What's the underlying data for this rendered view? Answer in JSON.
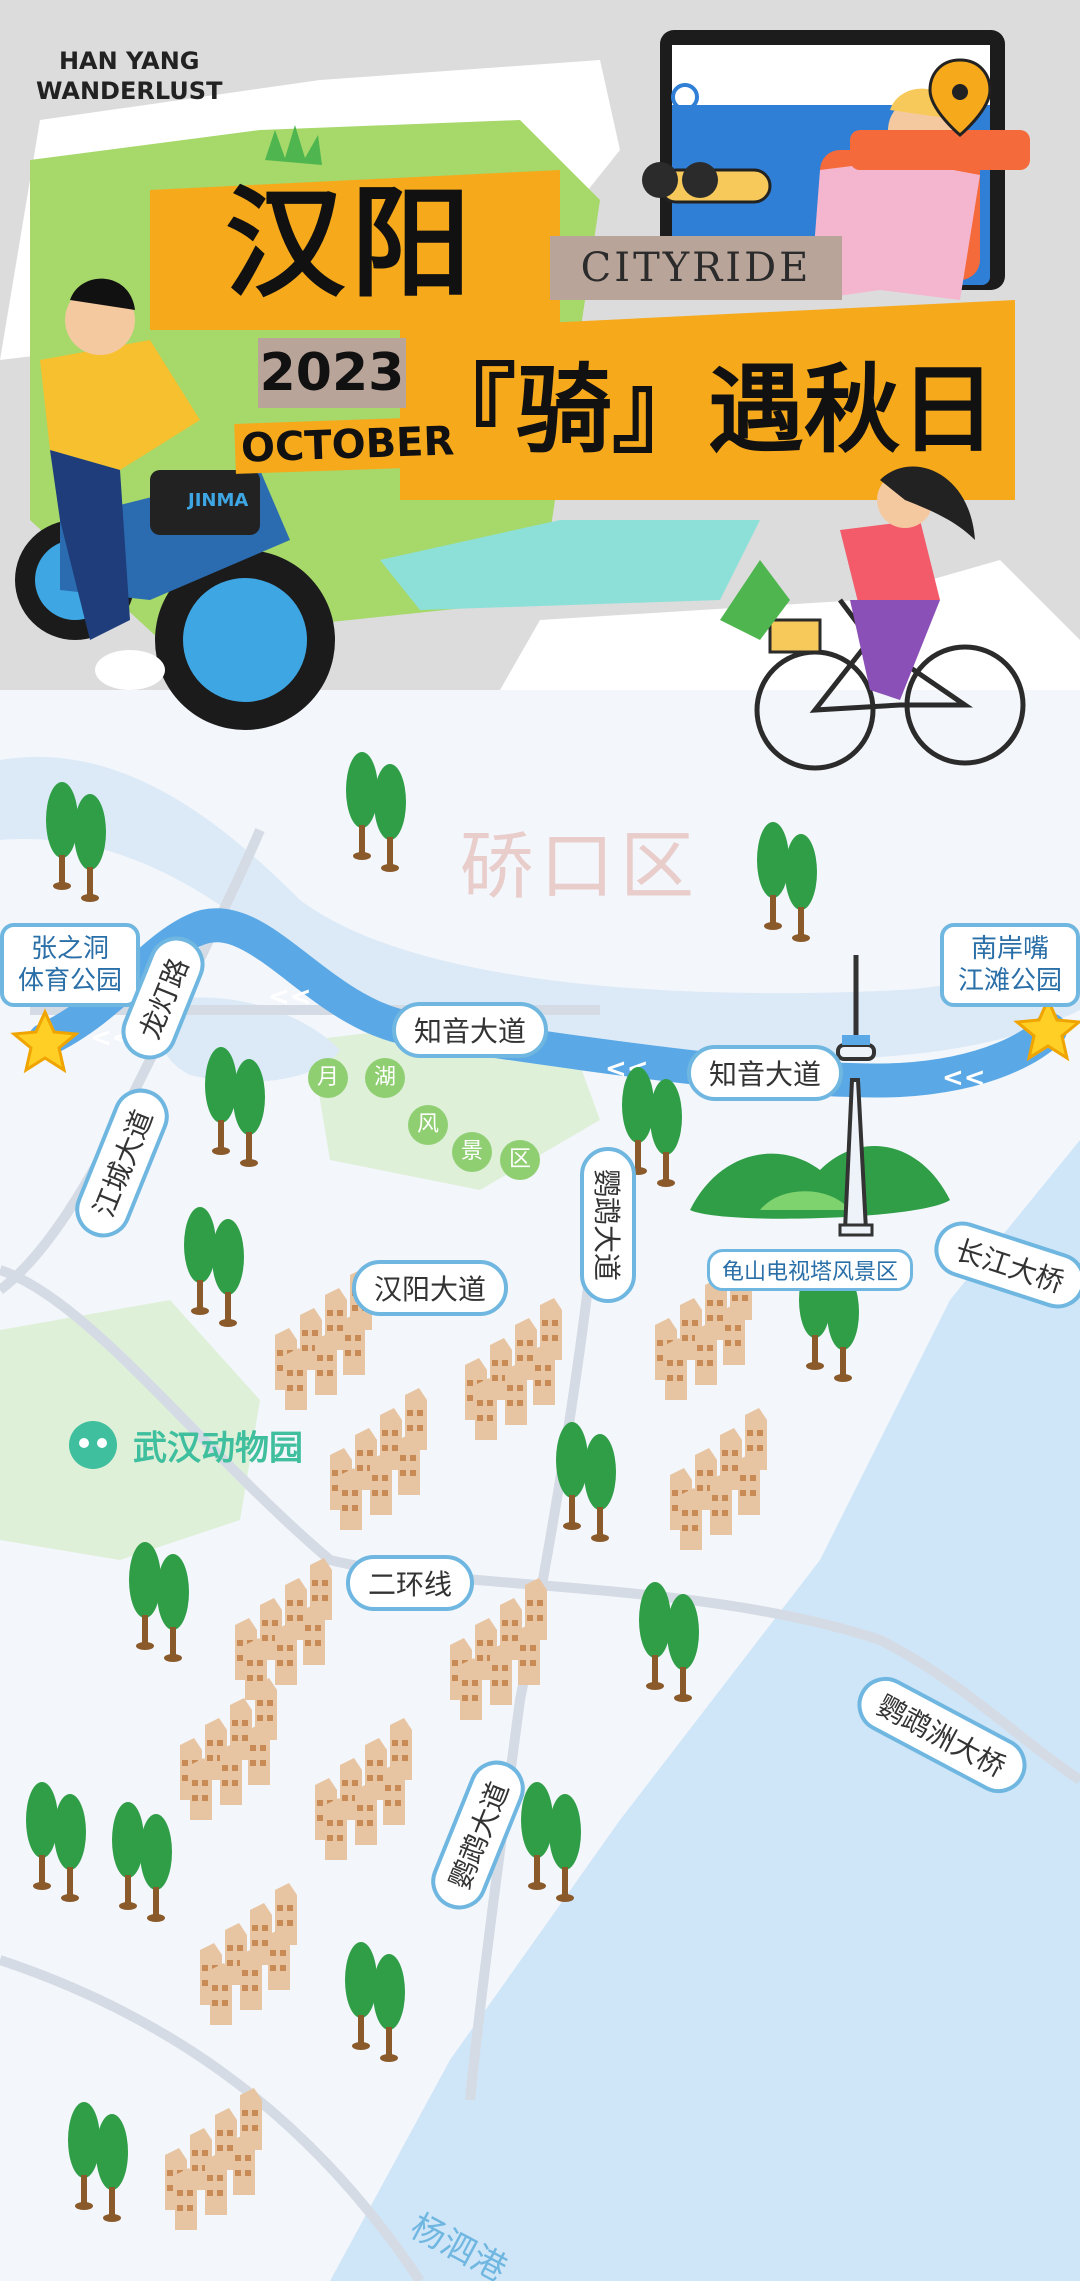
{
  "header": {
    "brand_line1": "HAN YANG",
    "brand_line2": "WANDERLUST",
    "title_main": "汉阳",
    "cityride": "CITYRIDE",
    "year": "2023",
    "month": "OCTOBER",
    "subtitle": "『骑』遇秋日",
    "bike_brand": "JINMA"
  },
  "map": {
    "district": "硚口区",
    "start_poi": "张之洞\n体育公园",
    "end_poi": "南岸嘴\n江滩公园",
    "roads": {
      "longdeng": "龙灯路",
      "zhiyin_1": "知音大道",
      "zhiyin_2": "知音大道",
      "jiangcheng": "江城大道",
      "yingwu_1": "鹦鹉大道",
      "hanyang": "汉阳大道",
      "changjiang_bridge": "长江大桥",
      "erhuan": "二环线",
      "yingwuzhou_bridge": "鹦鹉洲大桥",
      "yingwu_2": "鹦鹉大道",
      "yangsigang": "杨泗港"
    },
    "scenic_chars": [
      "月",
      "湖",
      "风",
      "景",
      "区"
    ],
    "tower_label": "龟山电视塔风景区",
    "zoo": "武汉动物园"
  },
  "colors": {
    "route": "#5aa9e6",
    "river": "#cfe5f8",
    "river_text": "#6fb7e0",
    "green": "#d9efd4",
    "header_gray": "#dcdcdc",
    "accent_orange": "#f7a91c",
    "title_box_taupe": "#b9a49a",
    "star": "#ffcf26"
  }
}
